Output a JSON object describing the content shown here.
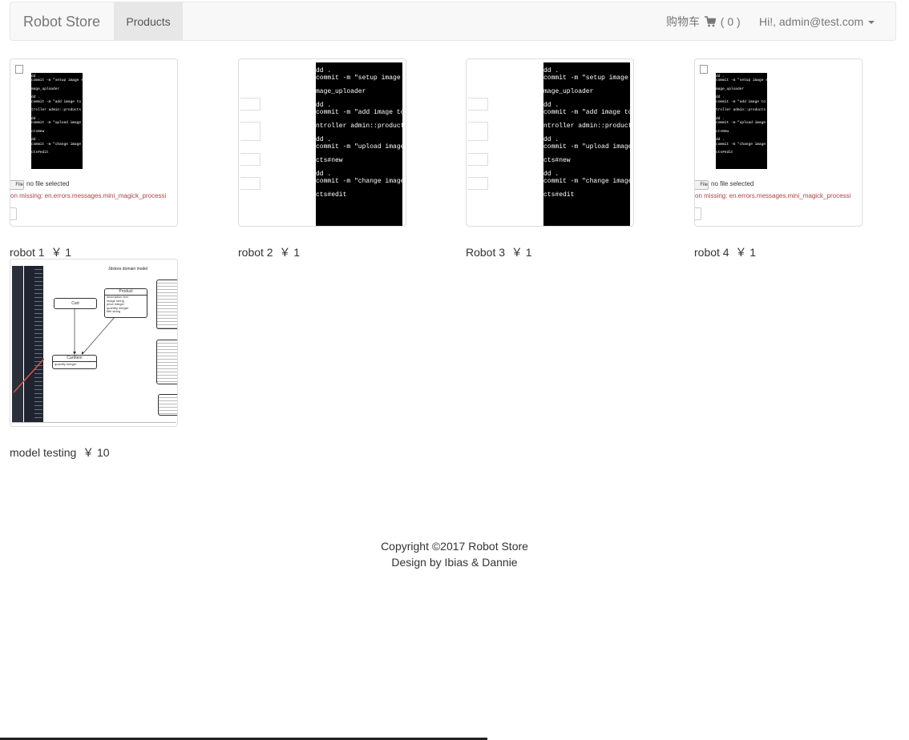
{
  "navbar": {
    "brand": "Robot Store",
    "products_label": "Products",
    "cart_label": "购物车",
    "cart_count": "( 0 )",
    "user_label": "Hi!, admin@test.com"
  },
  "products": [
    {
      "name": "robot 1",
      "price": "￥ 1"
    },
    {
      "name": "robot 2",
      "price": "￥ 1"
    },
    {
      "name": "Robot 3",
      "price": "￥ 1"
    },
    {
      "name": "robot 4",
      "price": "￥ 1"
    },
    {
      "name": "model testing",
      "price": "￥ 10"
    }
  ],
  "thumb_small": {
    "lines": [
      "dd .",
      "commit -m \"setup image st",
      "",
      "mage_uploader",
      "",
      "dd .",
      "commit -m \"add image to p",
      "",
      "troller admin::products",
      "",
      "dd .",
      "commit -m \"upload image i",
      "",
      "ctsNew",
      "",
      "dd .",
      "commit -m \"change image i",
      "",
      "cts#edit"
    ],
    "file_button": "File",
    "file_status": "no file selected",
    "error": "on missing: en.errors.messages.mini_magick_processi"
  },
  "thumb_large": {
    "lines": [
      "dd .",
      "commit -m \"setup image st",
      "",
      "mage_uploader",
      "",
      "dd .",
      "commit -m \"add image to p",
      "",
      "ntroller admin::products",
      "",
      "dd .",
      "commit -m \"upload image i",
      "",
      "cts#new",
      "",
      "dd .",
      "commit -m \"change image i",
      "",
      "cts#edit"
    ]
  },
  "diagram": {
    "title": "Jdstore domain model",
    "cart": "Cart",
    "product": "Product",
    "product_fields": [
      "description text",
      "image string",
      "price integer",
      "quantity integer",
      "title string"
    ],
    "cartitem": "CartItem",
    "cartitem_fields": [
      "quantity integer"
    ]
  },
  "footer": {
    "copyright": "Copyright ©2017 Robot Store",
    "design": "Design by Ibias & Dannie"
  }
}
